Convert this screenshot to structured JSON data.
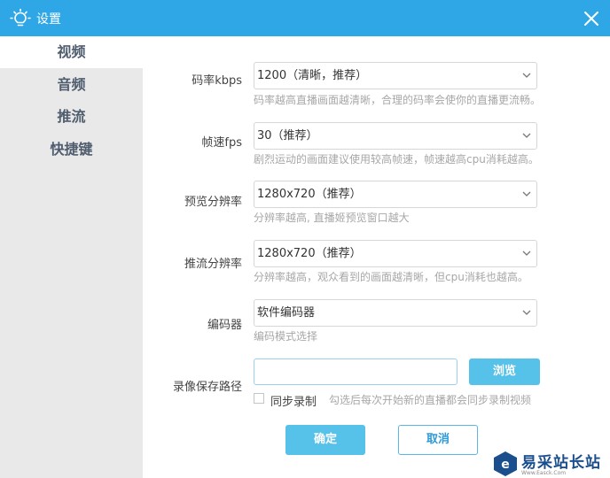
{
  "window": {
    "title": "设置"
  },
  "icons": {
    "title": "lightbulb-icon",
    "close": "close-icon",
    "dropdown": "chevron-down-icon",
    "watermark": "site-logo-icon"
  },
  "sidebar": {
    "items": [
      {
        "label": "视频",
        "active": true
      },
      {
        "label": "音频",
        "active": false
      },
      {
        "label": "推流",
        "active": false
      },
      {
        "label": "快捷键",
        "active": false
      }
    ]
  },
  "video": {
    "bitrate": {
      "label": "码率kbps",
      "value": "1200（清晰，推荐）",
      "hint": "码率越高直播画面越清晰，合理的码率会使你的直播更流畅。"
    },
    "fps": {
      "label": "帧速fps",
      "value": "30（推荐）",
      "hint": "剧烈运动的画面建议使用较高帧速，帧速越高cpu消耗越高。"
    },
    "preview_resolution": {
      "label": "预览分辨率",
      "value": "1280x720（推荐）",
      "hint": "分辨率越高, 直播姬预览窗口越大"
    },
    "stream_resolution": {
      "label": "推流分辨率",
      "value": "1280x720（推荐）",
      "hint": "分辨率越高，观众看到的画面越清晰，但cpu消耗也越高。"
    },
    "encoder": {
      "label": "编码器",
      "value": "软件编码器",
      "hint": "编码模式选择"
    },
    "record_path": {
      "label": "录像保存路径",
      "value": "",
      "browse_label": "浏览"
    },
    "sync_record": {
      "label": "同步录制",
      "checked": false,
      "hint": "勾选后每次开始新的直播都会同步录制视频"
    }
  },
  "footer": {
    "ok_label": "确定",
    "cancel_label": "取消"
  },
  "watermark": {
    "text": "易采站长站",
    "url": "Www.Easck.Com"
  },
  "colors": {
    "accent": "#2fa7e6",
    "button": "#56c1e9",
    "sidebar_bg": "#e9e9e9"
  }
}
